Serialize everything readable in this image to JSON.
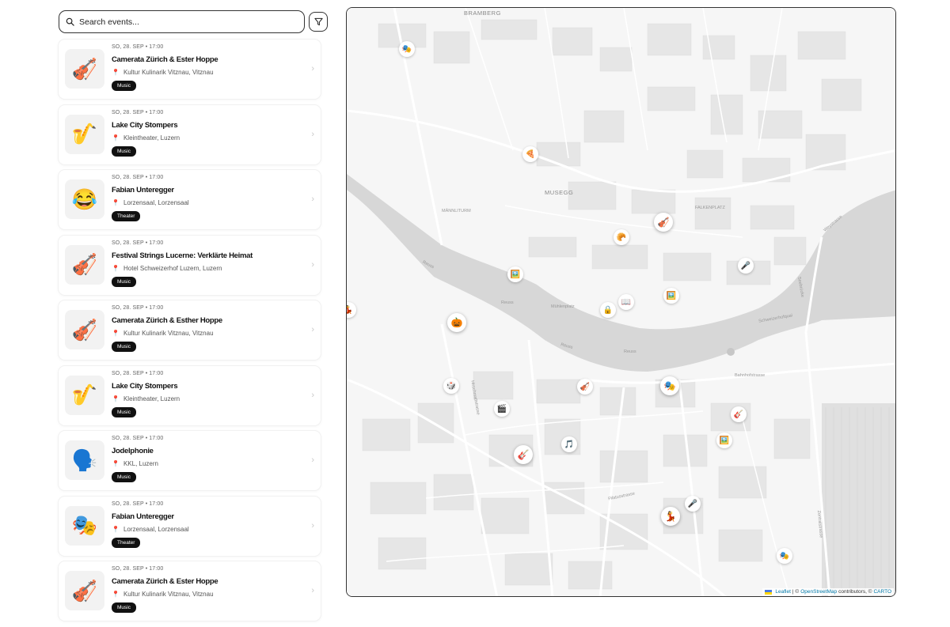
{
  "search": {
    "placeholder": "Search events..."
  },
  "events": [
    {
      "date": "SO, 28. SEP • 17:00",
      "title": "Camerata Zürich & Ester Hoppe",
      "venue": "Kultur Kulinarik Vitznau, Vitznau",
      "tag": "Music",
      "icon": "🎻",
      "icon_name": "violin-icon"
    },
    {
      "date": "SO, 28. SEP • 17:00",
      "title": "Lake City Stompers",
      "venue": "Kleintheater, Luzern",
      "tag": "Music",
      "icon": "🎷",
      "icon_name": "saxophone-icon"
    },
    {
      "date": "SO, 28. SEP • 17:00",
      "title": "Fabian Unteregger",
      "venue": "Lorzensaal, Lorzensaal",
      "tag": "Theater",
      "icon": "😂",
      "icon_name": "laughing-face-icon"
    },
    {
      "date": "SO, 28. SEP • 17:00",
      "title": "Festival Strings Lucerne: Verklärte Heimat",
      "venue": "Hotel Schweizerhof Luzern, Luzern",
      "tag": "Music",
      "icon": "🎻",
      "icon_name": "violin-icon"
    },
    {
      "date": "SO, 28. SEP • 17:00",
      "title": "Camerata Zürich & Esther Hoppe",
      "venue": "Kultur Kulinarik Vitznau, Vitznau",
      "tag": "Music",
      "icon": "🎻",
      "icon_name": "violin-icon"
    },
    {
      "date": "SO, 28. SEP • 17:00",
      "title": "Lake City Stompers",
      "venue": "Kleintheater, Luzern",
      "tag": "Music",
      "icon": "🎷",
      "icon_name": "saxophone-icon"
    },
    {
      "date": "SO, 28. SEP • 17:00",
      "title": "Jodelphonie",
      "venue": "KKL, Luzern",
      "tag": "Music",
      "icon": "🗣️",
      "icon_name": "speaking-head-icon"
    },
    {
      "date": "SO, 28. SEP • 17:00",
      "title": "Fabian Unteregger",
      "venue": "Lorzensaal, Lorzensaal",
      "tag": "Theater",
      "icon": "🎭",
      "icon_name": "theater-masks-icon"
    },
    {
      "date": "SO, 28. SEP • 17:00",
      "title": "Camerata Zürich & Ester Hoppe",
      "venue": "Kultur Kulinarik Vitznau, Vitznau",
      "tag": "Music",
      "icon": "🎻",
      "icon_name": "violin-icon"
    }
  ],
  "map": {
    "labels": {
      "bramberg": "BRAMBERG",
      "musegg": "MUSEGG"
    },
    "streets": {
      "reuss1": "Reuss",
      "reuss2": "Reuss",
      "reuss3": "Reuss",
      "reuss4": "Reuss",
      "schweizerhofquai": "Schweizerhofquai",
      "falkenplatz": "FALKENPLATZ",
      "mannliturm": "MÄNNLITURM",
      "muehlenplatz": "Mühlenplatz",
      "bahnhofstrasse": "Bahnhofstrasse",
      "pilatusstrasse": "Pilatusstrasse",
      "hirschmattstrasse": "Hirschmattstrasse",
      "zentralstrasse": "Zentralstrasse",
      "seebruecke": "Seebrücke",
      "weystrasse": "Weystrasse"
    },
    "markers": [
      {
        "icon": "🎭",
        "name": "theater-masks-marker"
      },
      {
        "icon": "🍕",
        "name": "pizza-marker"
      },
      {
        "icon": "🎻",
        "name": "violin-marker"
      },
      {
        "icon": "🥐",
        "name": "croissant-marker"
      },
      {
        "icon": "🎤",
        "name": "microphone-marker"
      },
      {
        "icon": "🖼️",
        "name": "picture-marker"
      },
      {
        "icon": "🖼️",
        "name": "picture-marker"
      },
      {
        "icon": "📖",
        "name": "book-marker"
      },
      {
        "icon": "🔒",
        "name": "lock-marker"
      },
      {
        "icon": "🎃",
        "name": "pumpkin-marker"
      },
      {
        "icon": "💃",
        "name": "dancer-marker"
      },
      {
        "icon": "🎲",
        "name": "dice-marker"
      },
      {
        "icon": "🎻",
        "name": "violin-marker"
      },
      {
        "icon": "🎭",
        "name": "theater-masks-marker"
      },
      {
        "icon": "🎸",
        "name": "guitar-marker"
      },
      {
        "icon": "🎬",
        "name": "film-marker"
      },
      {
        "icon": "🖼️",
        "name": "picture-marker"
      },
      {
        "icon": "🎵",
        "name": "music-note-marker"
      },
      {
        "icon": "🎸",
        "name": "guitar-marker"
      },
      {
        "icon": "🎤",
        "name": "microphone-marker"
      },
      {
        "icon": "💃",
        "name": "dancer-marker"
      },
      {
        "icon": "🎭",
        "name": "theater-masks-marker"
      }
    ],
    "attribution": {
      "leaflet": "Leaflet",
      "sep1": "| ©",
      "osm": "OpenStreetMap",
      "contrib": "contributors, ©",
      "carto": "CARTO"
    }
  }
}
